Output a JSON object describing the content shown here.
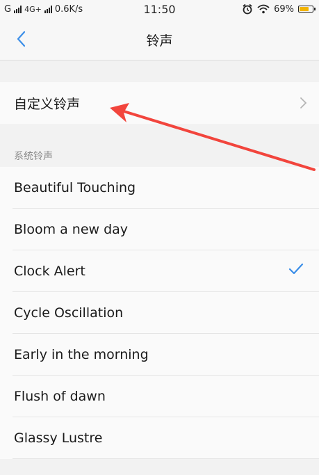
{
  "status_bar": {
    "carrier1": "G",
    "network": "4G+",
    "speed": "0.6K/s",
    "time": "11:50",
    "battery": "69%",
    "icons": [
      "signal-icon",
      "alarm-icon",
      "wifi-icon",
      "battery-icon"
    ]
  },
  "nav": {
    "title": "铃声",
    "back_icon": "chevron-left-icon"
  },
  "custom_ringtone": {
    "label": "自定义铃声"
  },
  "system_section": {
    "header": "系统铃声",
    "items": [
      {
        "label": "Beautiful Touching",
        "selected": false
      },
      {
        "label": "Bloom a new day",
        "selected": false
      },
      {
        "label": "Clock Alert",
        "selected": true
      },
      {
        "label": "Cycle Oscillation",
        "selected": false
      },
      {
        "label": "Early in the morning",
        "selected": false
      },
      {
        "label": "Flush of dawn",
        "selected": false
      },
      {
        "label": "Glassy Lustre",
        "selected": false
      }
    ]
  },
  "colors": {
    "accent": "#3b8ee8",
    "annotation_arrow": "#f2453d"
  }
}
